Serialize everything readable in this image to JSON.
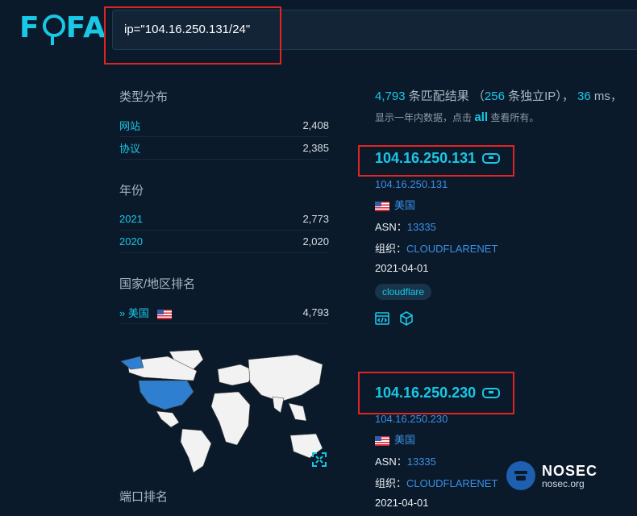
{
  "logo": {
    "text": "FOFA"
  },
  "search": {
    "query": "ip=\"104.16.250.131/24\""
  },
  "sidebar": {
    "type_title": "类型分布",
    "types": [
      {
        "label": "网站",
        "count": "2,408"
      },
      {
        "label": "协议",
        "count": "2,385"
      }
    ],
    "year_title": "年份",
    "years": [
      {
        "label": "2021",
        "count": "2,773"
      },
      {
        "label": "2020",
        "count": "2,020"
      }
    ],
    "country_title": "国家/地区排名",
    "countries": [
      {
        "label": "美国",
        "count": "4,793",
        "flag": "us-flag-icon"
      }
    ],
    "port_title": "端口排名"
  },
  "summary": {
    "total": "4,793",
    "total_text": "条匹配结果",
    "unique_open": "（",
    "unique": "256",
    "unique_text": "条独立IP）",
    "sep": "，",
    "time": "36",
    "time_unit": "ms，",
    "hint_pre": "显示一年内数据，点击",
    "hint_all": "all",
    "hint_post": "查看所有。"
  },
  "results": [
    {
      "title": "104.16.250.131",
      "ip": "104.16.250.131",
      "country": "美国",
      "asn_label": "ASN：",
      "asn": "13335",
      "org_label": "组织：",
      "org": "CLOUDFLARENET",
      "date": "2021-04-01",
      "tag": "cloudflare"
    },
    {
      "title": "104.16.250.230",
      "ip": "104.16.250.230",
      "country": "美国",
      "asn_label": "ASN：",
      "asn": "13335",
      "org_label": "组织：",
      "org": "CLOUDFLARENET",
      "date": "2021-04-01"
    }
  ],
  "watermark": {
    "title": "NOSEC",
    "sub": "nosec.org"
  },
  "colors": {
    "accent": "#19c7e6",
    "link": "#3a8fe6",
    "highlight": "#e02424",
    "bg": "#0b1a2a"
  }
}
